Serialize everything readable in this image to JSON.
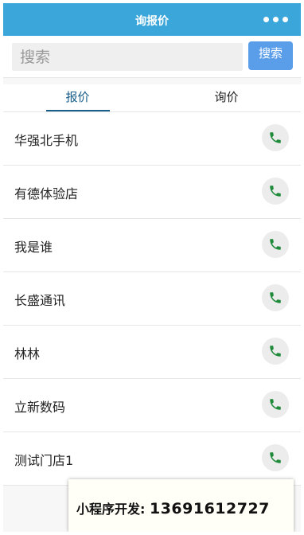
{
  "header": {
    "title": "询报价",
    "more_icon": "more-dots-icon"
  },
  "search": {
    "placeholder": "搜索",
    "button_label": "搜索"
  },
  "tabs": [
    {
      "label": "报价",
      "active": true
    },
    {
      "label": "询价",
      "active": false
    }
  ],
  "stores": [
    {
      "name": "华强北手机"
    },
    {
      "name": "有德体验店"
    },
    {
      "name": "我是谁"
    },
    {
      "name": "长盛通讯"
    },
    {
      "name": "林林"
    },
    {
      "name": "立新数码"
    },
    {
      "name": "测试门店1"
    }
  ],
  "promo": {
    "label": "小程序开发:",
    "phone": "13691612727"
  },
  "colors": {
    "header_bg": "#3aa6d9",
    "search_button": "#5a9de9",
    "active_tab": "#1a5f8a",
    "phone_icon": "#1f8a3a"
  }
}
